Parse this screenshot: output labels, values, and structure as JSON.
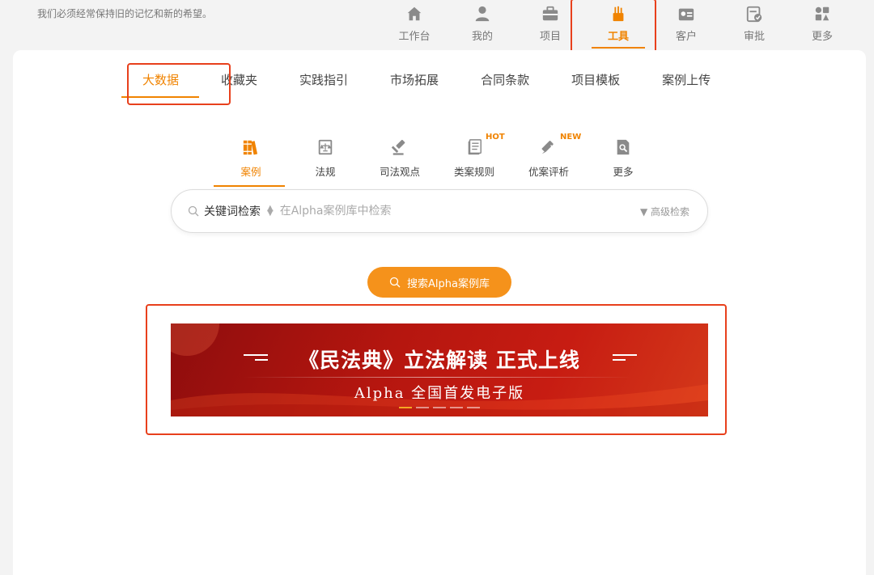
{
  "header": {
    "slogan": "我们必须经常保持旧的记忆和新的希望。",
    "nav": [
      {
        "label": "工作台",
        "icon": "home-icon"
      },
      {
        "label": "我的",
        "icon": "user-icon"
      },
      {
        "label": "项目",
        "icon": "briefcase-icon"
      },
      {
        "label": "工具",
        "icon": "tools-icon",
        "active": true
      },
      {
        "label": "客户",
        "icon": "client-card-icon"
      },
      {
        "label": "审批",
        "icon": "approval-icon"
      },
      {
        "label": "更多",
        "icon": "grid-more-icon"
      }
    ]
  },
  "tabs": [
    "大数据",
    "收藏夹",
    "实践指引",
    "市场拓展",
    "合同条款",
    "项目模板",
    "案例上传"
  ],
  "subtabs": [
    {
      "label": "案例",
      "icon": "books-icon",
      "active": true
    },
    {
      "label": "法规",
      "icon": "law-book-icon"
    },
    {
      "label": "司法观点",
      "icon": "gavel-icon"
    },
    {
      "label": "类案规则",
      "icon": "document-icon",
      "badge": "HOT"
    },
    {
      "label": "优案评析",
      "icon": "pen-icon",
      "badge": "NEW"
    },
    {
      "label": "更多",
      "icon": "search-doc-icon"
    }
  ],
  "search": {
    "mode": "关键词检索",
    "placeholder": "在Alpha案例库中检索",
    "advanced": "高级检索",
    "button": "搜索Alpha案例库"
  },
  "banner": {
    "title": "《民法典》立法解读 正式上线",
    "subtitle": "Alpha 全国首发电子版"
  },
  "colors": {
    "accent": "#f08300",
    "highlight": "#e8401c",
    "banner": "#b5160f"
  }
}
